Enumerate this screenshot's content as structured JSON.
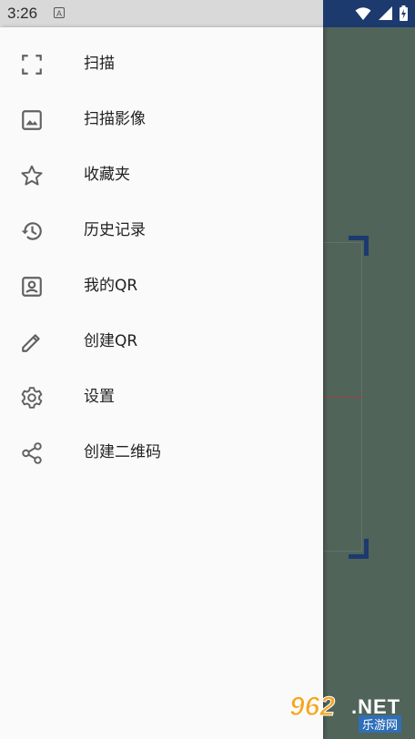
{
  "status_bar": {
    "time": "3:26",
    "notification_glyph": "A",
    "icons": [
      "wifi-icon",
      "signal-icon",
      "battery-icon"
    ]
  },
  "drawer": {
    "items": [
      {
        "label": "扫描",
        "icon": "scan-frame-icon"
      },
      {
        "label": "扫描影像",
        "icon": "image-icon"
      },
      {
        "label": "收藏夹",
        "icon": "star-icon"
      },
      {
        "label": "历史记录",
        "icon": "history-icon"
      },
      {
        "label": "我的QR",
        "icon": "account-box-icon"
      },
      {
        "label": "创建QR",
        "icon": "pencil-icon"
      },
      {
        "label": "设置",
        "icon": "gear-icon"
      },
      {
        "label": "创建二维码",
        "icon": "share-icon"
      }
    ]
  },
  "watermark": {
    "number": "962",
    "suffix": ".NET",
    "site_name": "乐游网"
  },
  "colors": {
    "camera_bg": "#50645a",
    "accent": "#1c3a6e",
    "icon_gray": "#616161",
    "laser": "#a04040"
  }
}
